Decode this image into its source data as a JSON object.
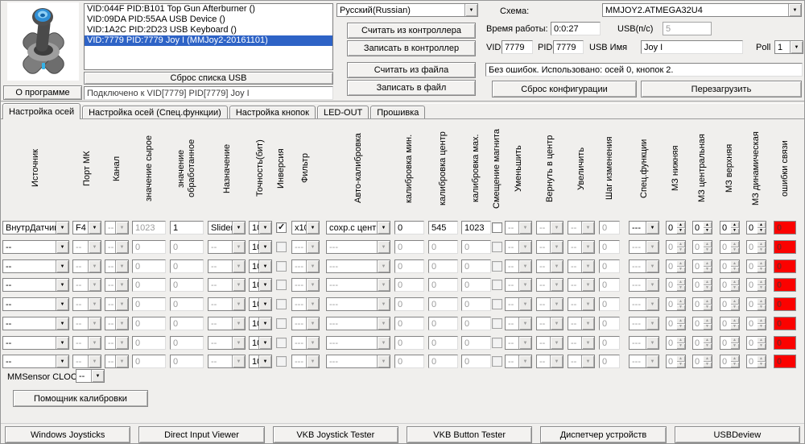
{
  "device_panel": {
    "about_button": "О программе",
    "usb_list": [
      "VID:044F PID:B101 Top Gun Afterburner ()",
      "VID:09DA PID:55AA USB Device ()",
      "VID:1A2C PID:2D23 USB Keyboard ()",
      "VID:7779 PID:7779 Joy I (MMJoy2-20161101)"
    ],
    "usb_list_selected_index": 3,
    "reset_usb_button": "Сброс списка USB",
    "connection_status": "Подключено к VID[7779] PID[7779] Joy I"
  },
  "controller_panel": {
    "language_select": "Русский(Russian)",
    "read_controller_button": "Считать из контроллера",
    "write_controller_button": "Записать в контроллер",
    "read_file_button": "Считать из файла",
    "write_file_button": "Записать в файл"
  },
  "config_panel": {
    "scheme_label": "Схема:",
    "scheme_value": "MMJOY2.ATMEGA32U4",
    "uptime_label": "Время работы:",
    "uptime_value": "0:0:27",
    "usb_ps_label": "USB(п/с)",
    "usb_ps_value": "5",
    "vid_label": "VID",
    "vid_value": "7779",
    "pid_label": "PID",
    "pid_value": "7779",
    "usb_name_label": "USB Имя",
    "usb_name_value": "Joy I",
    "poll_label": "Poll",
    "poll_value": "1",
    "status_message": "Без ошибок. Использовано: осей 0, кнопок 2.",
    "reset_config_button": "Сброс конфигурации",
    "reboot_button": "Перезагрузить"
  },
  "tabs": [
    {
      "label": "Настройка осей",
      "active": true
    },
    {
      "label": "Настройка осей (Спец.функции)",
      "active": false
    },
    {
      "label": "Настройка кнопок",
      "active": false
    },
    {
      "label": "LED-OUT",
      "active": false
    },
    {
      "label": "Прошивка",
      "active": false
    }
  ],
  "axes_tab": {
    "columns": [
      "Источник",
      "Порт МК",
      "Канал",
      "значение сырое",
      "значение обработанное",
      "Назначение",
      "Точность(бит)",
      "Инверсия",
      "Фильтр",
      "Авто-калибровка",
      "калибровка мин.",
      "калибровка центр",
      "калибровка мах.",
      "Смещение магнита",
      "Уменьшить",
      "Вернуть в центр",
      "Увеличить",
      "Шаг изменения",
      "Спец.функции",
      "МЗ нижняя",
      "МЗ центральная",
      "МЗ верхняя",
      "МЗ динамическая",
      "ошибки связи"
    ],
    "rows": [
      {
        "active": true,
        "source": "ВнутрДатчик",
        "port": "F4",
        "channel": "--",
        "raw": "1023",
        "processed": "1",
        "destination": "Slider",
        "precision": "10",
        "inversion": true,
        "filter": "x10",
        "autocal": "сохр.с центро",
        "cal_min": "0",
        "cal_center": "545",
        "cal_max": "1023",
        "magnet_offset": false,
        "decrease": "--",
        "return_center": "--",
        "increase": "--",
        "step": "0",
        "spec_func": "---",
        "mz_low": "0",
        "mz_center": "0",
        "mz_high": "0",
        "mz_dynamic": "0",
        "link_errors": "0"
      },
      {
        "active": false,
        "source": "--",
        "port": "--",
        "channel": "--",
        "raw": "0",
        "processed": "0",
        "destination": "--",
        "precision": "10",
        "inversion": false,
        "filter": "---",
        "autocal": "---",
        "cal_min": "0",
        "cal_center": "0",
        "cal_max": "0",
        "magnet_offset": false,
        "decrease": "--",
        "return_center": "--",
        "increase": "--",
        "step": "0",
        "spec_func": "---",
        "mz_low": "0",
        "mz_center": "0",
        "mz_high": "0",
        "mz_dynamic": "0",
        "link_errors": "0"
      },
      {
        "active": false,
        "source": "--",
        "port": "--",
        "channel": "--",
        "raw": "0",
        "processed": "0",
        "destination": "--",
        "precision": "10",
        "inversion": false,
        "filter": "---",
        "autocal": "---",
        "cal_min": "0",
        "cal_center": "0",
        "cal_max": "0",
        "magnet_offset": false,
        "decrease": "--",
        "return_center": "--",
        "increase": "--",
        "step": "0",
        "spec_func": "---",
        "mz_low": "0",
        "mz_center": "0",
        "mz_high": "0",
        "mz_dynamic": "0",
        "link_errors": "0"
      },
      {
        "active": false,
        "source": "--",
        "port": "--",
        "channel": "--",
        "raw": "0",
        "processed": "0",
        "destination": "--",
        "precision": "10",
        "inversion": false,
        "filter": "---",
        "autocal": "---",
        "cal_min": "0",
        "cal_center": "0",
        "cal_max": "0",
        "magnet_offset": false,
        "decrease": "--",
        "return_center": "--",
        "increase": "--",
        "step": "0",
        "spec_func": "---",
        "mz_low": "0",
        "mz_center": "0",
        "mz_high": "0",
        "mz_dynamic": "0",
        "link_errors": "0"
      },
      {
        "active": false,
        "source": "--",
        "port": "--",
        "channel": "--",
        "raw": "0",
        "processed": "0",
        "destination": "--",
        "precision": "10",
        "inversion": false,
        "filter": "---",
        "autocal": "---",
        "cal_min": "0",
        "cal_center": "0",
        "cal_max": "0",
        "magnet_offset": false,
        "decrease": "--",
        "return_center": "--",
        "increase": "--",
        "step": "0",
        "spec_func": "---",
        "mz_low": "0",
        "mz_center": "0",
        "mz_high": "0",
        "mz_dynamic": "0",
        "link_errors": "0"
      },
      {
        "active": false,
        "source": "--",
        "port": "--",
        "channel": "--",
        "raw": "0",
        "processed": "0",
        "destination": "--",
        "precision": "10",
        "inversion": false,
        "filter": "---",
        "autocal": "---",
        "cal_min": "0",
        "cal_center": "0",
        "cal_max": "0",
        "magnet_offset": false,
        "decrease": "--",
        "return_center": "--",
        "increase": "--",
        "step": "0",
        "spec_func": "---",
        "mz_low": "0",
        "mz_center": "0",
        "mz_high": "0",
        "mz_dynamic": "0",
        "link_errors": "0"
      },
      {
        "active": false,
        "source": "--",
        "port": "--",
        "channel": "--",
        "raw": "0",
        "processed": "0",
        "destination": "--",
        "precision": "10",
        "inversion": false,
        "filter": "---",
        "autocal": "---",
        "cal_min": "0",
        "cal_center": "0",
        "cal_max": "0",
        "magnet_offset": false,
        "decrease": "--",
        "return_center": "--",
        "increase": "--",
        "step": "0",
        "spec_func": "---",
        "mz_low": "0",
        "mz_center": "0",
        "mz_high": "0",
        "mz_dynamic": "0",
        "link_errors": "0"
      },
      {
        "active": false,
        "source": "--",
        "port": "--",
        "channel": "--",
        "raw": "0",
        "processed": "0",
        "destination": "--",
        "precision": "10",
        "inversion": false,
        "filter": "---",
        "autocal": "---",
        "cal_min": "0",
        "cal_center": "0",
        "cal_max": "0",
        "magnet_offset": false,
        "decrease": "--",
        "return_center": "--",
        "increase": "--",
        "step": "0",
        "spec_func": "---",
        "mz_low": "0",
        "mz_center": "0",
        "mz_high": "0",
        "mz_dynamic": "0",
        "link_errors": "0"
      }
    ],
    "mmsensor_label": "MMSensor CLOCK",
    "mmsensor_value": "--",
    "calib_wizard_button": "Помощник калибровки"
  },
  "bottom_buttons": [
    "Windows Joysticks",
    "Direct Input Viewer",
    "VKB Joystick Tester",
    "VKB Button Tester",
    "Диспетчер устройств",
    "USBDeview"
  ]
}
